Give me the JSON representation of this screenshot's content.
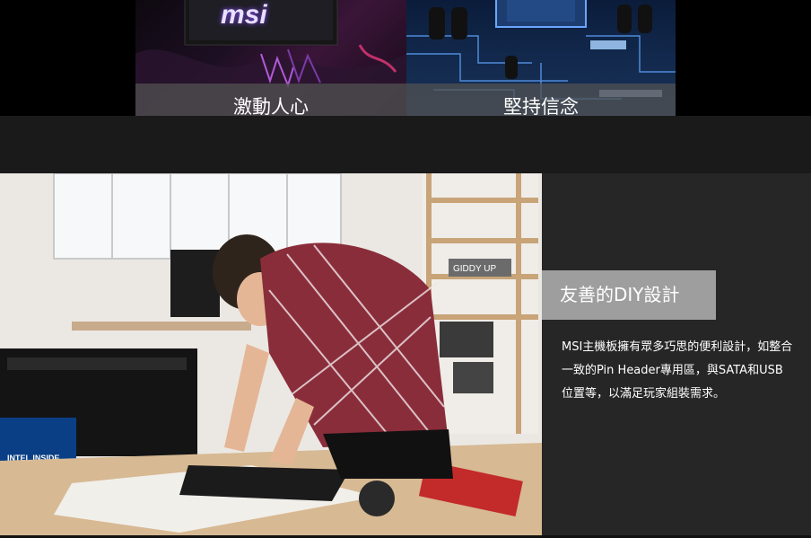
{
  "tiles": [
    {
      "caption": "激動人心",
      "logo_text": "msi"
    },
    {
      "caption": "堅持信念"
    }
  ],
  "feature": {
    "title": "友善的DIY設計",
    "body": "MSI主機板擁有眾多巧思的便利設計，如整合一致的Pin Header專用區，與SATA和USB 位置等，以滿足玩家組裝需求。"
  },
  "photo": {
    "box_label": "INTEL INSIDE",
    "shelf_sign": "GIDDY UP"
  },
  "colors": {
    "page_bg": "#000000",
    "band_bg": "#1a1a1a",
    "panel_bg": "#262626",
    "title_bg": "#9e9e9e",
    "caption_bg": "#525252"
  }
}
